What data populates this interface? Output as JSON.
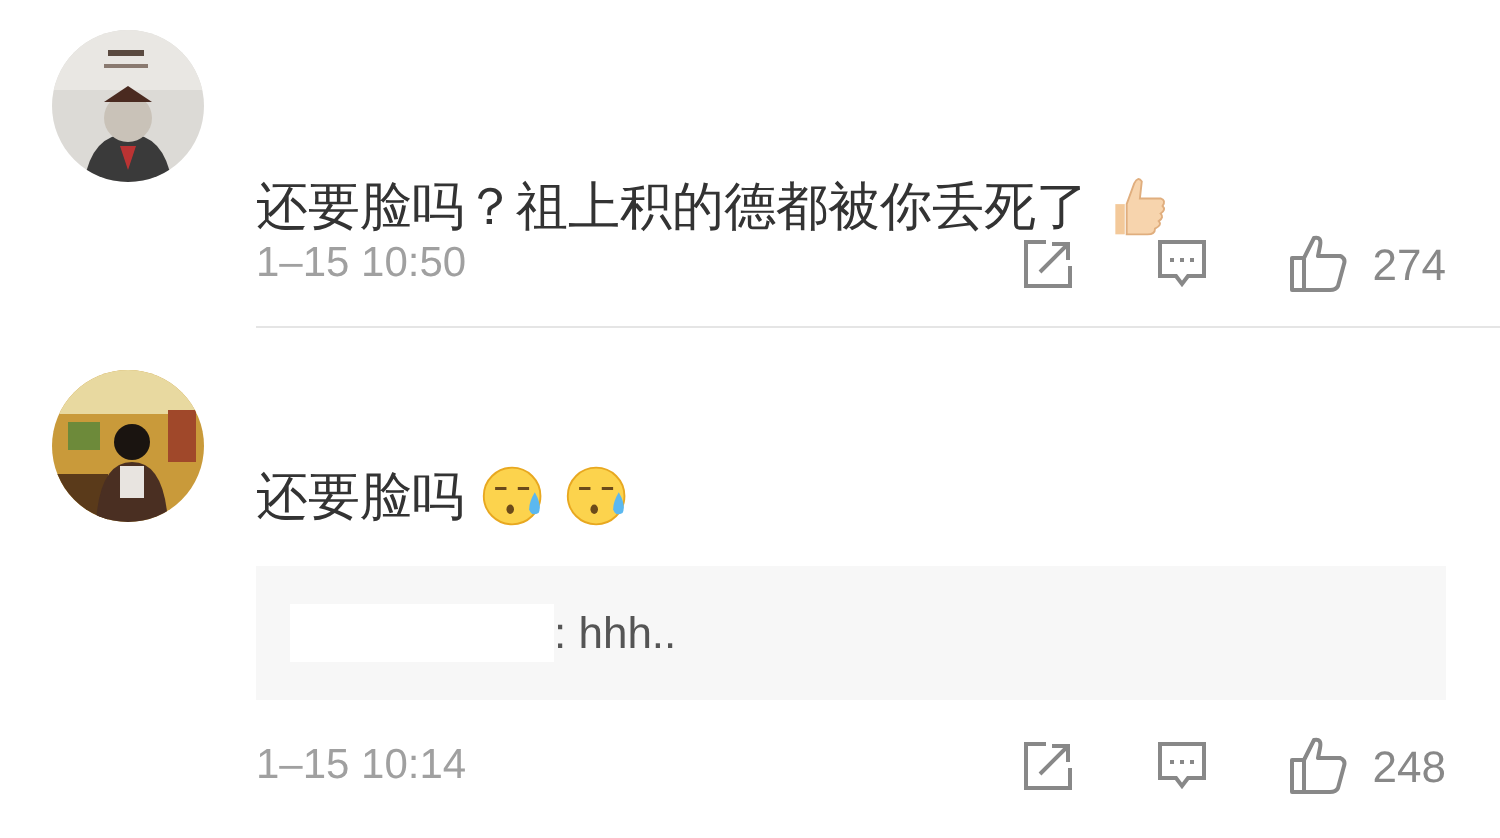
{
  "comments": [
    {
      "avatar": {
        "kind": "picture"
      },
      "text": "还要脸吗？祖上积的德都被你丢死了",
      "emojis": [
        {
          "kind": "thumbs_up"
        }
      ],
      "time": "1–15 10:50",
      "likes": "274"
    },
    {
      "avatar": {
        "kind": "picture"
      },
      "text": "还要脸吗",
      "emojis": [
        {
          "kind": "sweat"
        },
        {
          "kind": "sweat"
        }
      ],
      "reply": {
        "redacted": true,
        "text": ": hhh.."
      },
      "time": "1–15 10:14",
      "likes": "248"
    }
  ]
}
